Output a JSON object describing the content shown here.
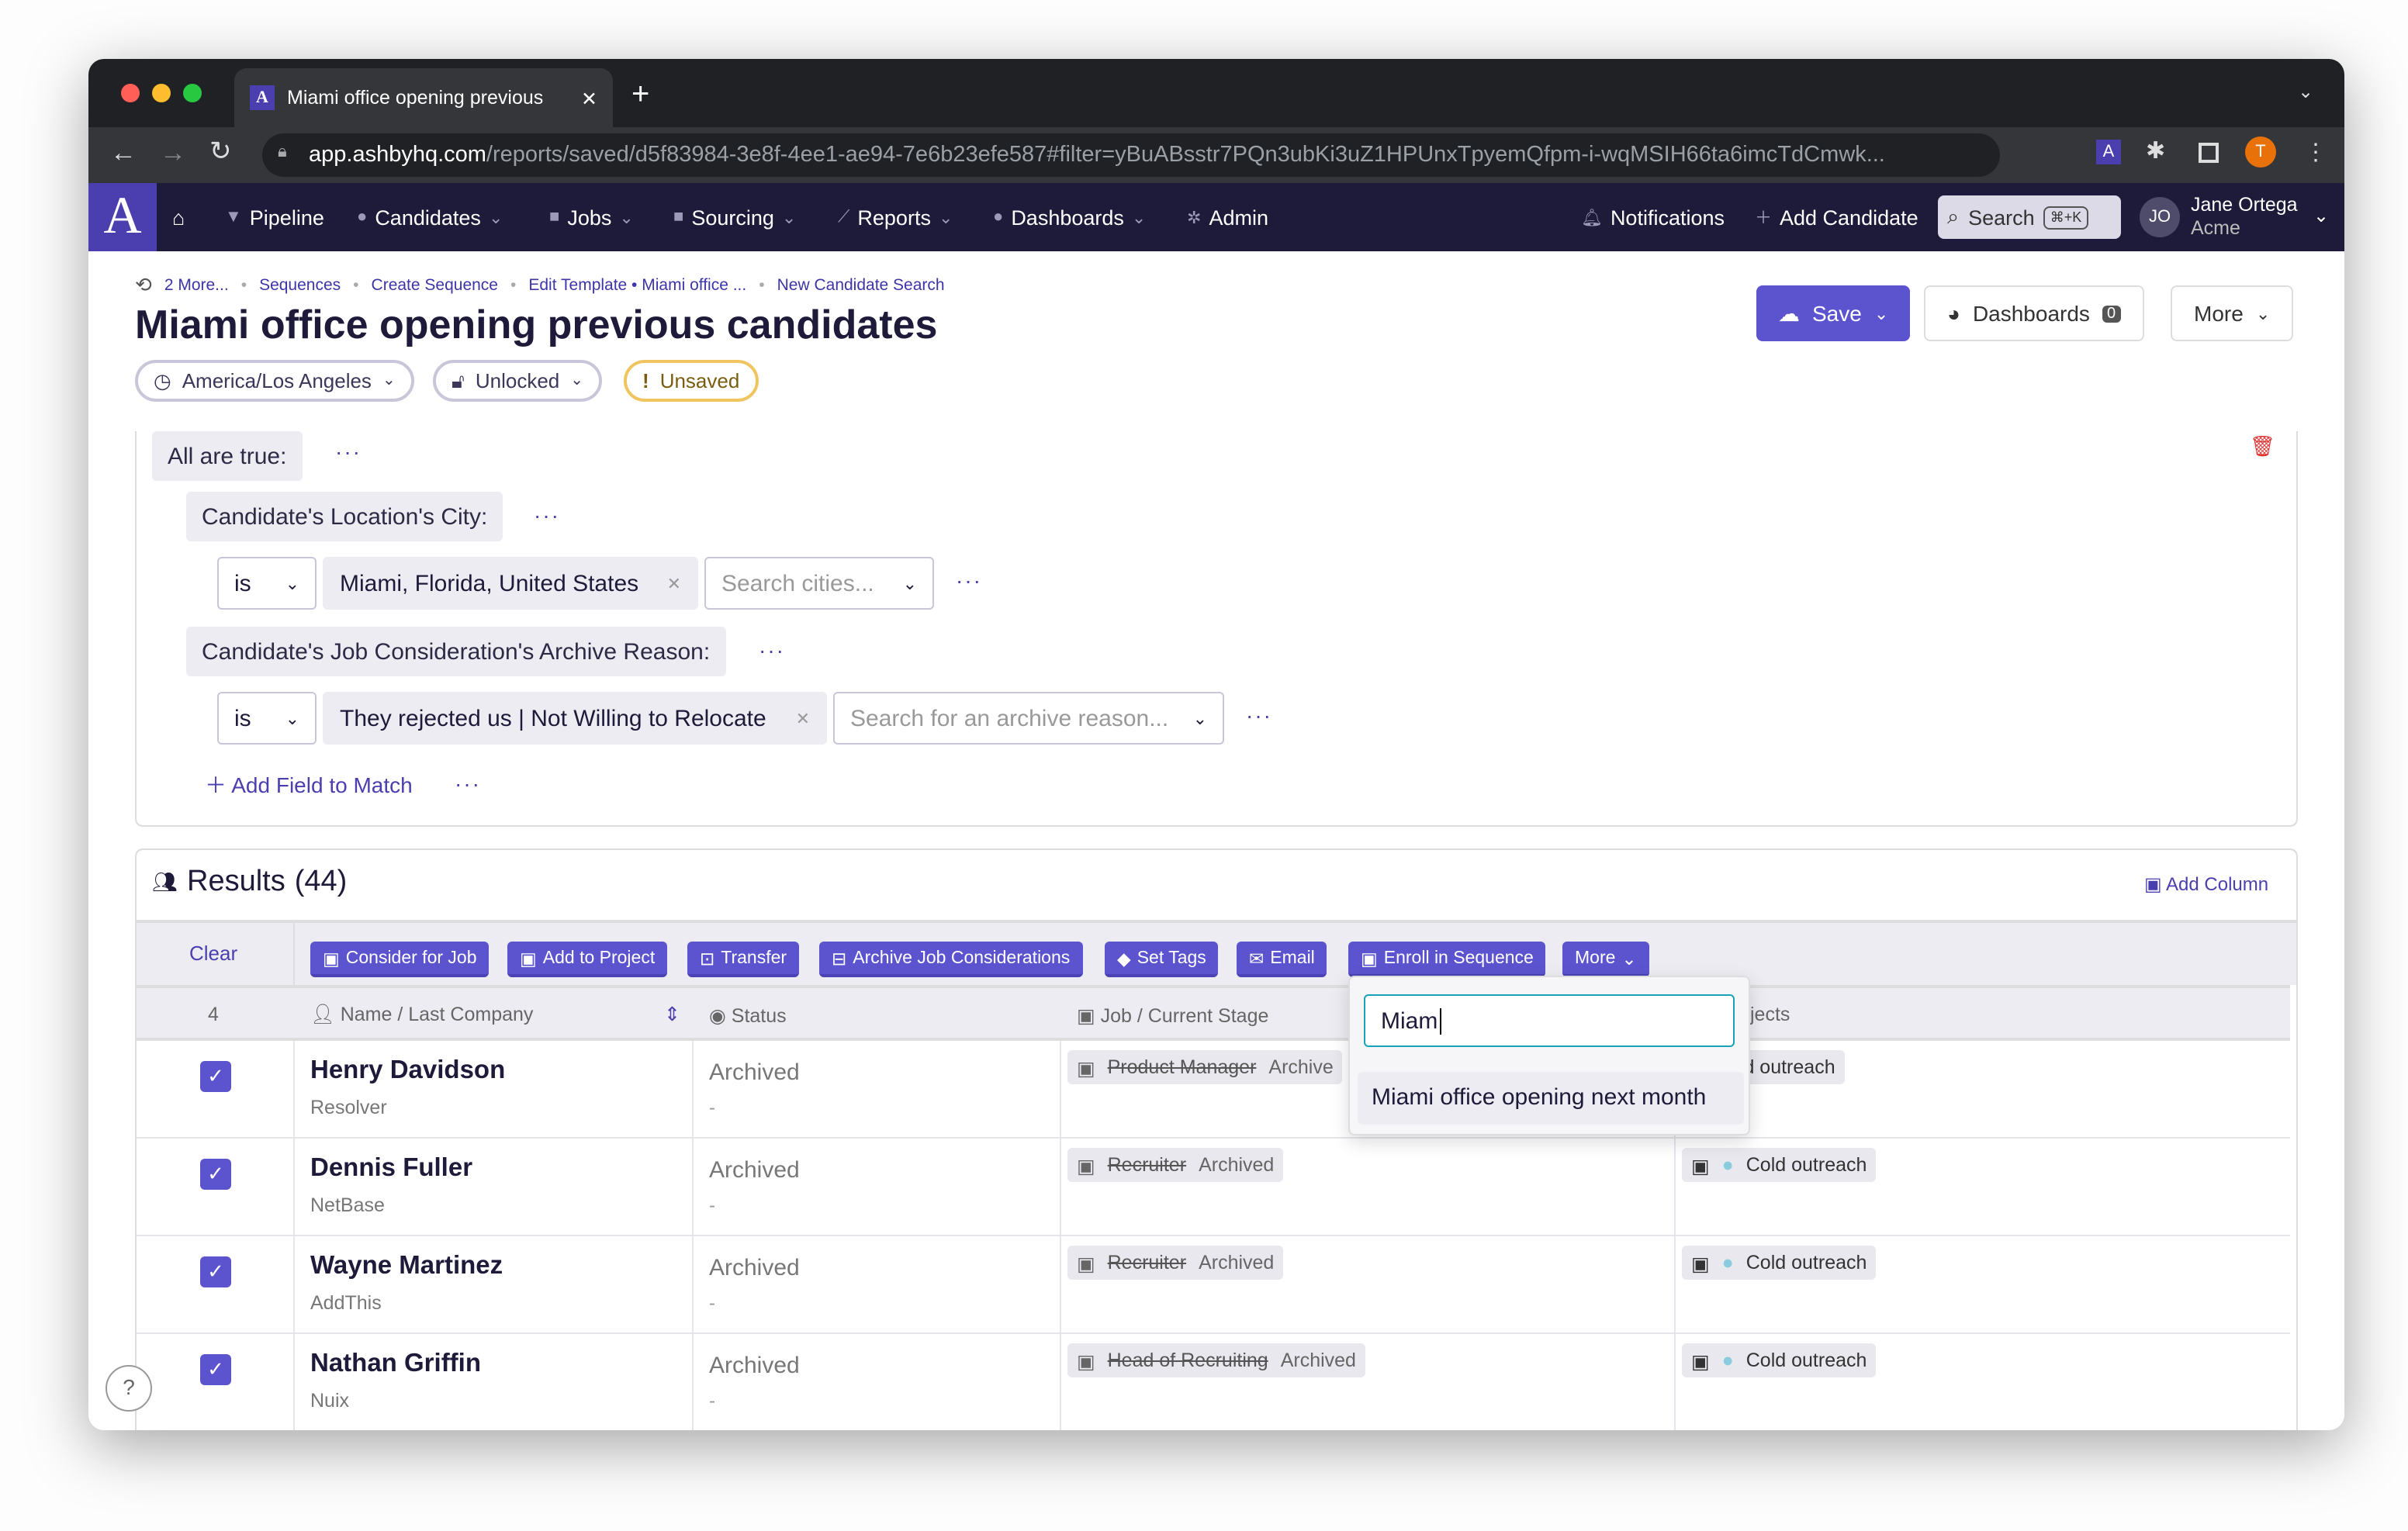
{
  "browser": {
    "tab_title": "Miami office opening previous",
    "url_host": "app.ashbyhq.com",
    "url_path": "/reports/saved/d5f83984-3e8f-4ee1-ae94-7e6b23efe587#filter=yBuABsstr7PQn3ubKi3uZ1HPUnxTpyemQfpm-i-wqMSIH66ta6imcTdCmwk...",
    "profile_initial": "T"
  },
  "nav": {
    "items": [
      {
        "label": "Pipeline"
      },
      {
        "label": "Candidates"
      },
      {
        "label": "Jobs"
      },
      {
        "label": "Sourcing"
      },
      {
        "label": "Reports"
      },
      {
        "label": "Dashboards"
      },
      {
        "label": "Admin"
      }
    ],
    "notifications": "Notifications",
    "add_candidate": "Add Candidate",
    "search": "Search",
    "search_kbd": "⌘+K",
    "user_initials": "JO",
    "user_name": "Jane Ortega",
    "user_org": "Acme"
  },
  "breadcrumb": [
    "2 More...",
    "Sequences",
    "Create Sequence",
    "Edit Template • Miami office ...",
    "New Candidate Search"
  ],
  "page": {
    "title": "Miami office opening previous candidates",
    "timezone": "America/Los Angeles",
    "lock": "Unlocked",
    "status": "Unsaved",
    "save": "Save",
    "dashboards": "Dashboards",
    "dashboards_count": "0",
    "more": "More"
  },
  "filters": {
    "root": "All are true:",
    "field1": "Candidate's Location's City:",
    "op1": "is",
    "value1": "Miami, Florida, United States",
    "placeholder1": "Search cities...",
    "field2": "Candidate's Job Consideration's Archive Reason:",
    "op2": "is",
    "value2": "They rejected us | Not Willing to Relocate",
    "placeholder2": "Search for an archive reason...",
    "add_field": "Add Field to Match"
  },
  "results": {
    "title": "Results",
    "count": "(44)",
    "add_column": "Add Column",
    "clear": "Clear",
    "selected_count": "4",
    "actions": [
      "Consider for Job",
      "Add to Project",
      "Transfer",
      "Archive Job Considerations",
      "Set Tags",
      "Email",
      "Enroll in Sequence",
      "More"
    ],
    "columns": [
      "Name / Last Company",
      "Status",
      "Job / Current Stage",
      "jects"
    ],
    "rows": [
      {
        "name": "Henry Davidson",
        "company": "Resolver",
        "status": "Archived",
        "status_sub": "-",
        "job": "Product Manager",
        "stage": "Archive",
        "project": "old outreach"
      },
      {
        "name": "Dennis Fuller",
        "company": "NetBase",
        "status": "Archived",
        "status_sub": "-",
        "job": "Recruiter",
        "stage": "Archived",
        "project": "Cold outreach"
      },
      {
        "name": "Wayne Martinez",
        "company": "AddThis",
        "status": "Archived",
        "status_sub": "-",
        "job": "Recruiter",
        "stage": "Archived",
        "project": "Cold outreach"
      },
      {
        "name": "Nathan Griffin",
        "company": "Nuix",
        "status": "Archived",
        "status_sub": "-",
        "job": "Head of Recruiting",
        "stage": "Archived",
        "project": "Cold outreach"
      }
    ]
  },
  "sequence_popup": {
    "input_value": "Miam",
    "option": "Miami office opening next month"
  },
  "colors": {
    "accent": "#5c54cf",
    "nav_bg": "#1e1b3a"
  }
}
